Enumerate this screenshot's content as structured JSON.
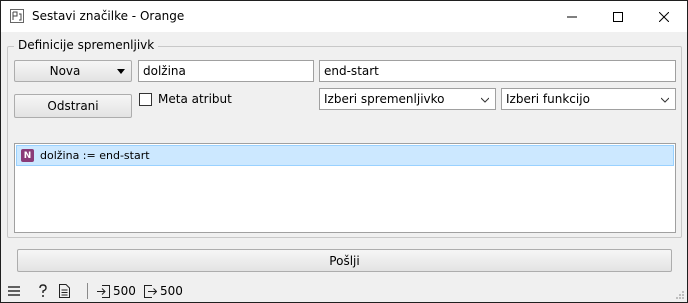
{
  "window": {
    "title": "Sestavi značilke - Orange"
  },
  "group": {
    "title": "Definicije spremenljivk"
  },
  "controls": {
    "new_button": "Nova",
    "remove_button": "Odstrani",
    "name_value": "dolžina",
    "expression_value": "end-start",
    "meta_checkbox_label": "Meta atribut",
    "meta_checked": false,
    "select_variable": "Izberi spremenljivko",
    "select_function": "Izberi funkcijo"
  },
  "features": [
    {
      "type_badge": "N",
      "label": "dolžina := end-start",
      "selected": true
    }
  ],
  "send_button": "Pošlji",
  "statusbar": {
    "input_count": "500",
    "output_count": "500"
  },
  "colors": {
    "selection": "#cce8ff",
    "numeric_badge": "#8a3b78"
  }
}
